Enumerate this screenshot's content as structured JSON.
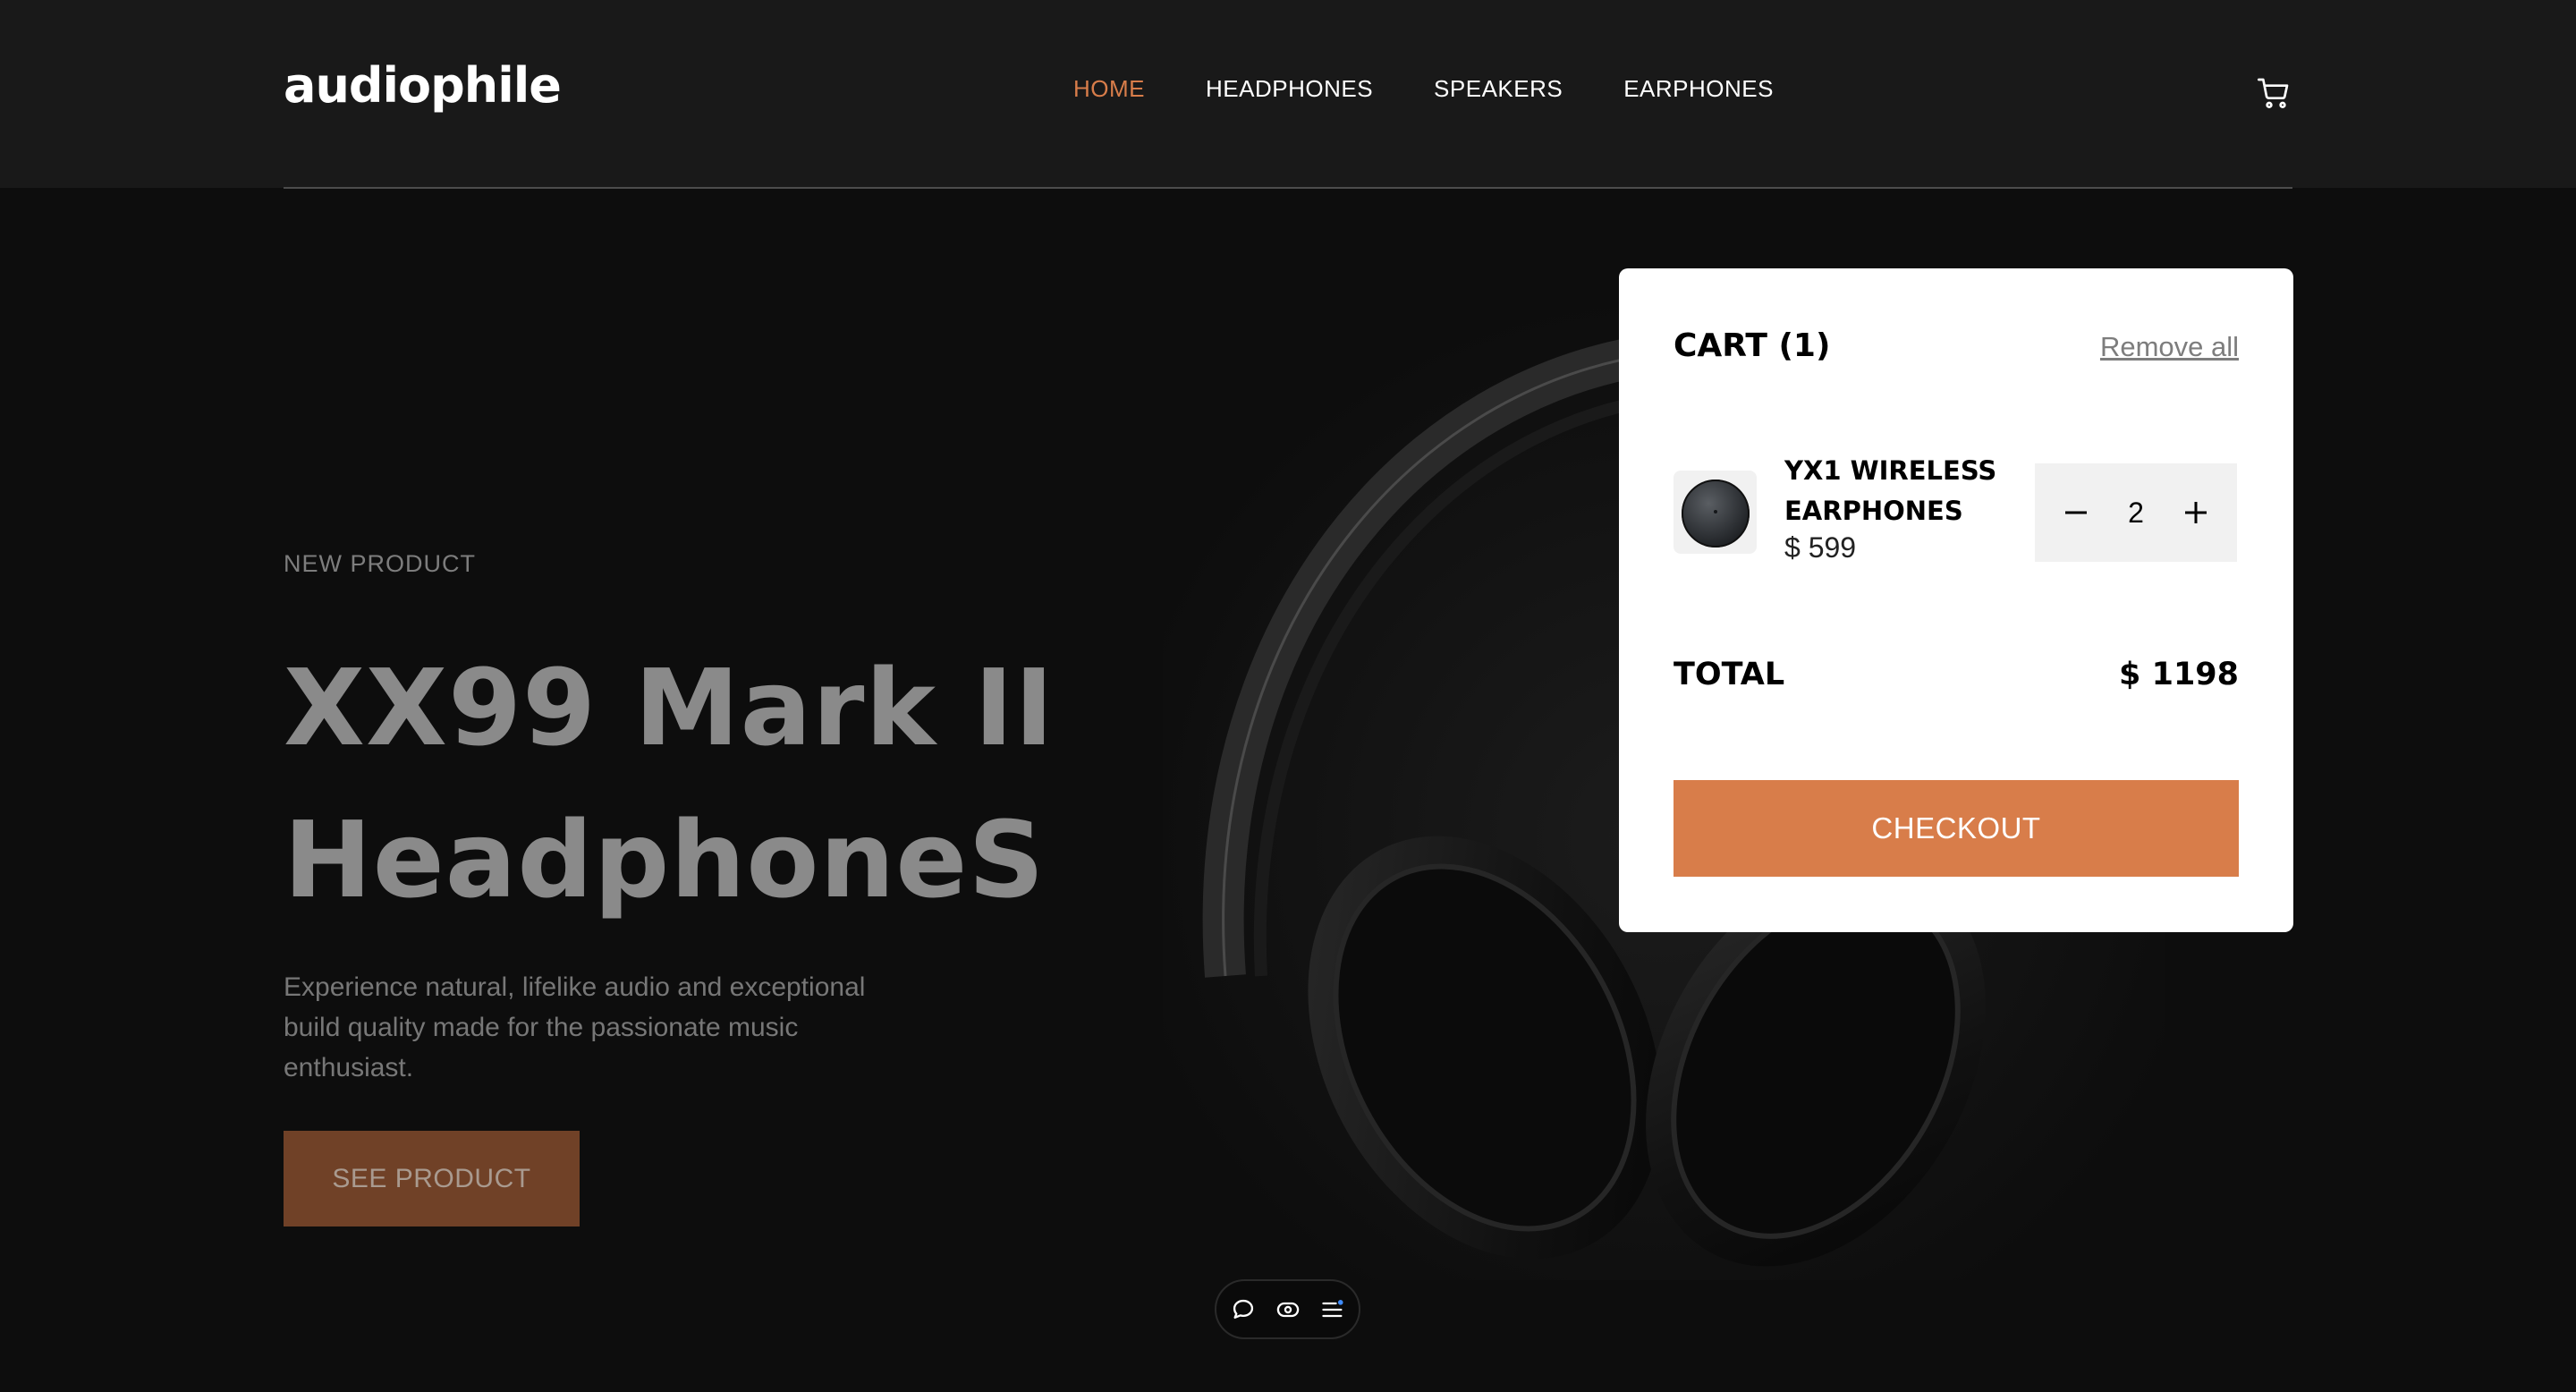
{
  "header": {
    "logo": "audiophile",
    "nav": [
      {
        "label": "HOME",
        "active": true
      },
      {
        "label": "HEADPHONES",
        "active": false
      },
      {
        "label": "SPEAKERS",
        "active": false
      },
      {
        "label": "EARPHONES",
        "active": false
      }
    ],
    "cart_icon": "cart-icon"
  },
  "hero": {
    "eyebrow": "NEW PRODUCT",
    "title_line1": "XX99 Mark II",
    "title_line2": "HeadphoneS",
    "description": "Experience natural, lifelike audio and exceptional build quality made for the passionate music enthusiast.",
    "cta": "SEE PRODUCT"
  },
  "cart": {
    "title": "CART (1)",
    "remove_all": "Remove all",
    "items": [
      {
        "name": "YX1 WIRELESS EARPHONES",
        "price": "$ 599",
        "quantity": "2"
      }
    ],
    "decrement_symbol": "−",
    "increment_symbol": "+",
    "total_label": "TOTAL",
    "total_value": "$ 1198",
    "checkout": "CHECKOUT"
  },
  "toolbar": {
    "icons": [
      "comment-icon",
      "eye-icon",
      "list-icon"
    ]
  },
  "colors": {
    "accent": "#d87d4a",
    "header_bg": "#191919",
    "hero_bg": "#0d0d0d",
    "panel_bg": "#ffffff"
  }
}
